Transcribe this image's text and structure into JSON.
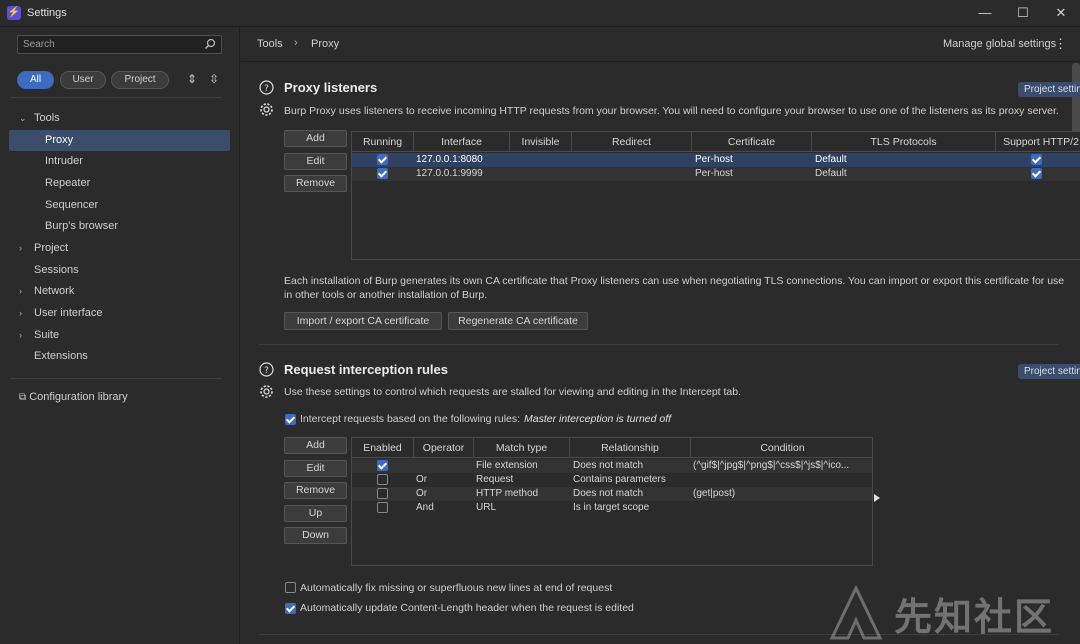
{
  "window": {
    "title": "Settings",
    "min": "—",
    "max": "☐",
    "close": "✕"
  },
  "sidebar": {
    "search_placeholder": "Search",
    "filters": [
      "All",
      "User",
      "Project"
    ],
    "nav": [
      {
        "label": "Tools",
        "chev": "⌄"
      },
      {
        "label": "Proxy"
      },
      {
        "label": "Intruder"
      },
      {
        "label": "Repeater"
      },
      {
        "label": "Sequencer"
      },
      {
        "label": "Burp's browser"
      },
      {
        "label": "Project",
        "chev": "›"
      },
      {
        "label": "Sessions"
      },
      {
        "label": "Network",
        "chev": "›"
      },
      {
        "label": "User interface",
        "chev": "›"
      },
      {
        "label": "Suite",
        "chev": "›"
      },
      {
        "label": "Extensions"
      }
    ],
    "config_library": "Configuration library"
  },
  "header": {
    "breadcrumb": [
      "Tools",
      "Proxy"
    ],
    "sep": "›",
    "manage": "Manage global settings",
    "kebab": "⋮"
  },
  "proxy_listeners": {
    "title": "Proxy listeners",
    "badge": "Project setting",
    "desc": "Burp Proxy uses listeners to receive incoming HTTP requests from your browser. You will need to configure your browser to use one of the listeners as its proxy server.",
    "buttons": [
      "Add",
      "Edit",
      "Remove"
    ],
    "columns": [
      "Running",
      "Interface",
      "Invisible",
      "Redirect",
      "Certificate",
      "TLS Protocols",
      "Support HTTP/2"
    ],
    "rows": [
      {
        "running": true,
        "interface": "127.0.0.1:8080",
        "invisible": "",
        "redirect": "",
        "certificate": "Per-host",
        "tls": "Default",
        "http2": true
      },
      {
        "running": true,
        "interface": "127.0.0.1:9999",
        "invisible": "",
        "redirect": "",
        "certificate": "Per-host",
        "tls": "Default",
        "http2": true
      }
    ],
    "ca_text": "Each installation of Burp generates its own CA certificate that Proxy listeners can use when negotiating TLS connections. You can import or export this certificate for use in other tools or another installation of Burp.",
    "ca_buttons": [
      "Import / export CA certificate",
      "Regenerate CA certificate"
    ]
  },
  "interception": {
    "title": "Request interception rules",
    "badge": "Project setting",
    "desc": "Use these settings to control which requests are stalled for viewing and editing in the Intercept tab.",
    "intercept_label": "Intercept requests based on the following rules:",
    "intercept_status": "Master interception is turned off",
    "buttons": [
      "Add",
      "Edit",
      "Remove",
      "Up",
      "Down"
    ],
    "columns": [
      "Enabled",
      "Operator",
      "Match type",
      "Relationship",
      "Condition"
    ],
    "rows": [
      {
        "enabled": true,
        "operator": "",
        "match": "File extension",
        "rel": "Does not match",
        "cond": "(^gif$|^jpg$|^png$|^css$|^js$|^ico..."
      },
      {
        "enabled": false,
        "operator": "Or",
        "match": "Request",
        "rel": "Contains parameters",
        "cond": ""
      },
      {
        "enabled": false,
        "operator": "Or",
        "match": "HTTP method",
        "rel": "Does not match",
        "cond": "(get|post)"
      },
      {
        "enabled": false,
        "operator": "And",
        "match": "URL",
        "rel": "Is in target scope",
        "cond": ""
      }
    ],
    "opt1": "Automatically fix missing or superfluous new lines at end of request",
    "opt2": "Automatically update Content-Length header when the request is edited"
  },
  "watermark": "先知社区",
  "colors": {
    "accent": "#3d6bbf",
    "selection": "#3c4d6b",
    "background": "#2b2b2b"
  }
}
